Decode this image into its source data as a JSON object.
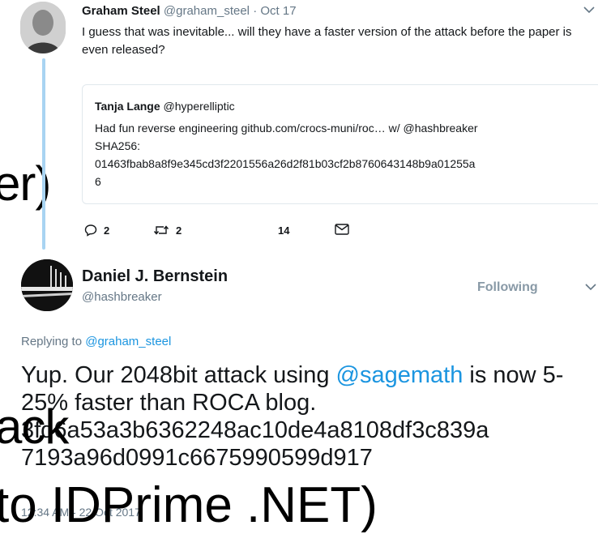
{
  "background_slide": {
    "line1": "er)",
    "line2": ")",
    "line3": "ack",
    "line4": "to IDPrime .NET)"
  },
  "tweet1": {
    "author_name": "Graham Steel",
    "author_handle": "@graham_steel",
    "date": "· Oct 17",
    "text": "I guess that was inevitable... will they have a faster version of the attack before the paper is even released?",
    "quoted": {
      "author_name": "Tanja Lange",
      "author_handle": "@hyperelliptic",
      "line1": "Had fun reverse engineering github.com/crocs-muni/roc… w/ @hashbreaker",
      "line2": "SHA256:",
      "line3": "01463fbab8a8f9e345cd3f2201556a26d2f81b03cf2b8760643148b9a01255a",
      "line4": "6"
    },
    "actions": {
      "replies": "2",
      "retweets": "2",
      "likes": "14"
    }
  },
  "tweet2": {
    "author_name": "Daniel J. Bernstein",
    "author_handle": "@hashbreaker",
    "follow_state": "Following",
    "replying_prefix": "Replying to",
    "replying_to": "@graham_steel",
    "text_before": "Yup. Our 2048bit attack using ",
    "text_mention": "@sagemath",
    "text_after": " is now 5-25% faster than ROCA blog.",
    "hash_line1": "3fd6a53a3b6362248ac10de4a8108df3c839a",
    "hash_line2": "7193a96d0991c6675990599d917",
    "timestamp": "12:34 AM - 22 Oct 2017"
  },
  "colors": {
    "link": "#1b95e0",
    "secondary": "#657786",
    "thread": "#a8d4f2"
  }
}
